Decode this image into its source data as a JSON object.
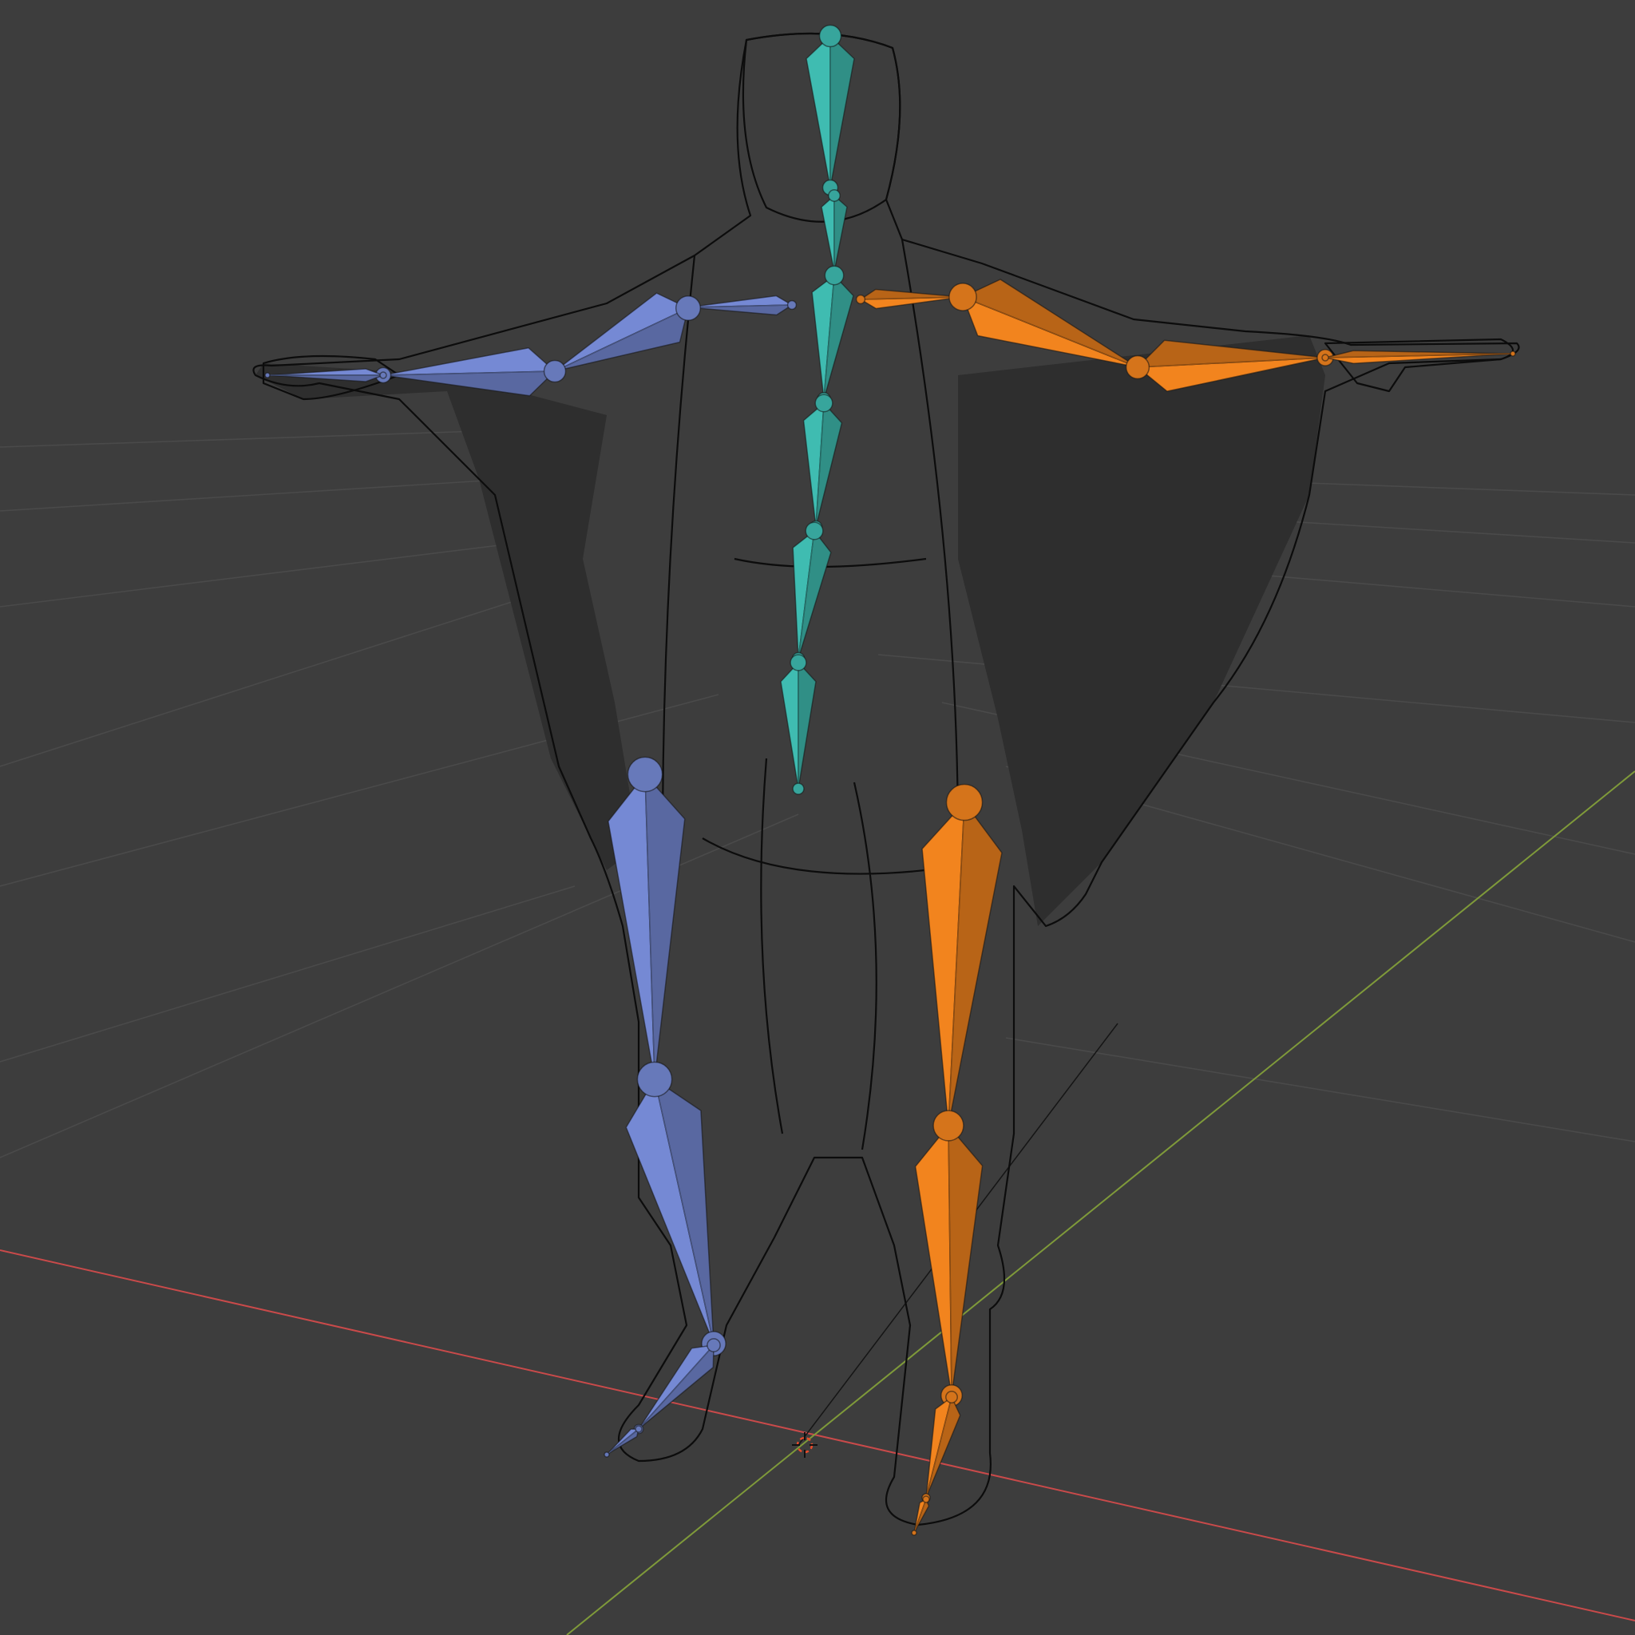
{
  "viewport": {
    "background": "#3d3d3d",
    "grid_color": "#4a4a4a",
    "axes": {
      "x_axis_color": "#c94a4a",
      "y_axis_color": "#7f9a3a"
    },
    "origin_marker": "3d-cursor"
  },
  "mesh": {
    "display": "wireframe",
    "wire_color": "#111111"
  },
  "armature": {
    "colors": {
      "spine": "#3aaea4",
      "left": "#6c7fc4",
      "right": "#e07a1c"
    },
    "bone_groups": [
      "spine",
      "left-arm",
      "right-arm",
      "left-leg",
      "right-leg"
    ]
  }
}
